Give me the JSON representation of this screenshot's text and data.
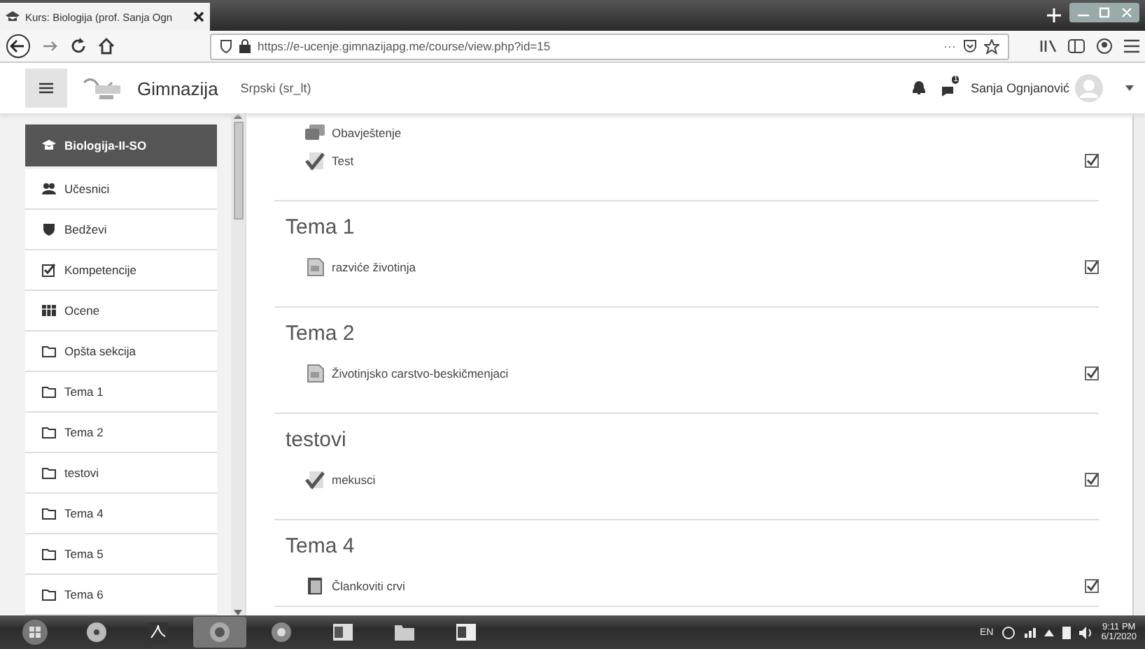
{
  "browser": {
    "tab_title": "Kurs: Biologija (prof. Sanja Ogn",
    "url": "https://e-ucenje.gimnazijapg.me/course/view.php?id=15",
    "menu": "···"
  },
  "navbar": {
    "brand": "Gimnazija",
    "language": "Srpski (sr_lt)",
    "message_count": "1",
    "user": "Sanja Ognjanović"
  },
  "sidebar": {
    "items": [
      {
        "label": "Biologija-II-SO",
        "kind": "course",
        "selected": true
      },
      {
        "label": "Učesnici",
        "kind": "participants",
        "selected": false
      },
      {
        "label": "Bedževi",
        "kind": "badges",
        "selected": false
      },
      {
        "label": "Kompetencije",
        "kind": "competencies",
        "selected": false
      },
      {
        "label": "Ocene",
        "kind": "grades",
        "selected": false
      },
      {
        "label": "Opšta sekcija",
        "kind": "section",
        "selected": false
      },
      {
        "label": "Tema 1",
        "kind": "section",
        "selected": false
      },
      {
        "label": "Tema 2",
        "kind": "section",
        "selected": false
      },
      {
        "label": "testovi",
        "kind": "section",
        "selected": false
      },
      {
        "label": "Tema 4",
        "kind": "section",
        "selected": false
      },
      {
        "label": "Tema 5",
        "kind": "section",
        "selected": false
      },
      {
        "label": "Tema 6",
        "kind": "section",
        "selected": false
      }
    ]
  },
  "sections": [
    {
      "activities": [
        {
          "name": "Obavještenje",
          "kind": "forum",
          "completed": false
        },
        {
          "name": "Test",
          "kind": "quiz",
          "completed": true
        }
      ]
    },
    {
      "title": "Tema 1",
      "activities": [
        {
          "name": "razviće životinja",
          "kind": "file",
          "completed": true
        }
      ]
    },
    {
      "title": "Tema 2",
      "activities": [
        {
          "name": "Životinjsko carstvo-beskičmenjaci",
          "kind": "file",
          "completed": true
        }
      ]
    },
    {
      "title": "testovi",
      "activities": [
        {
          "name": "mekusci",
          "kind": "quiz",
          "completed": true
        }
      ]
    },
    {
      "title": "Tema 4",
      "activities": [
        {
          "name": "Člankoviti crvi",
          "kind": "book",
          "completed": true
        }
      ]
    }
  ],
  "taskbar": {
    "language": "EN",
    "time": "9:11 PM",
    "date": "6/1/2020"
  }
}
